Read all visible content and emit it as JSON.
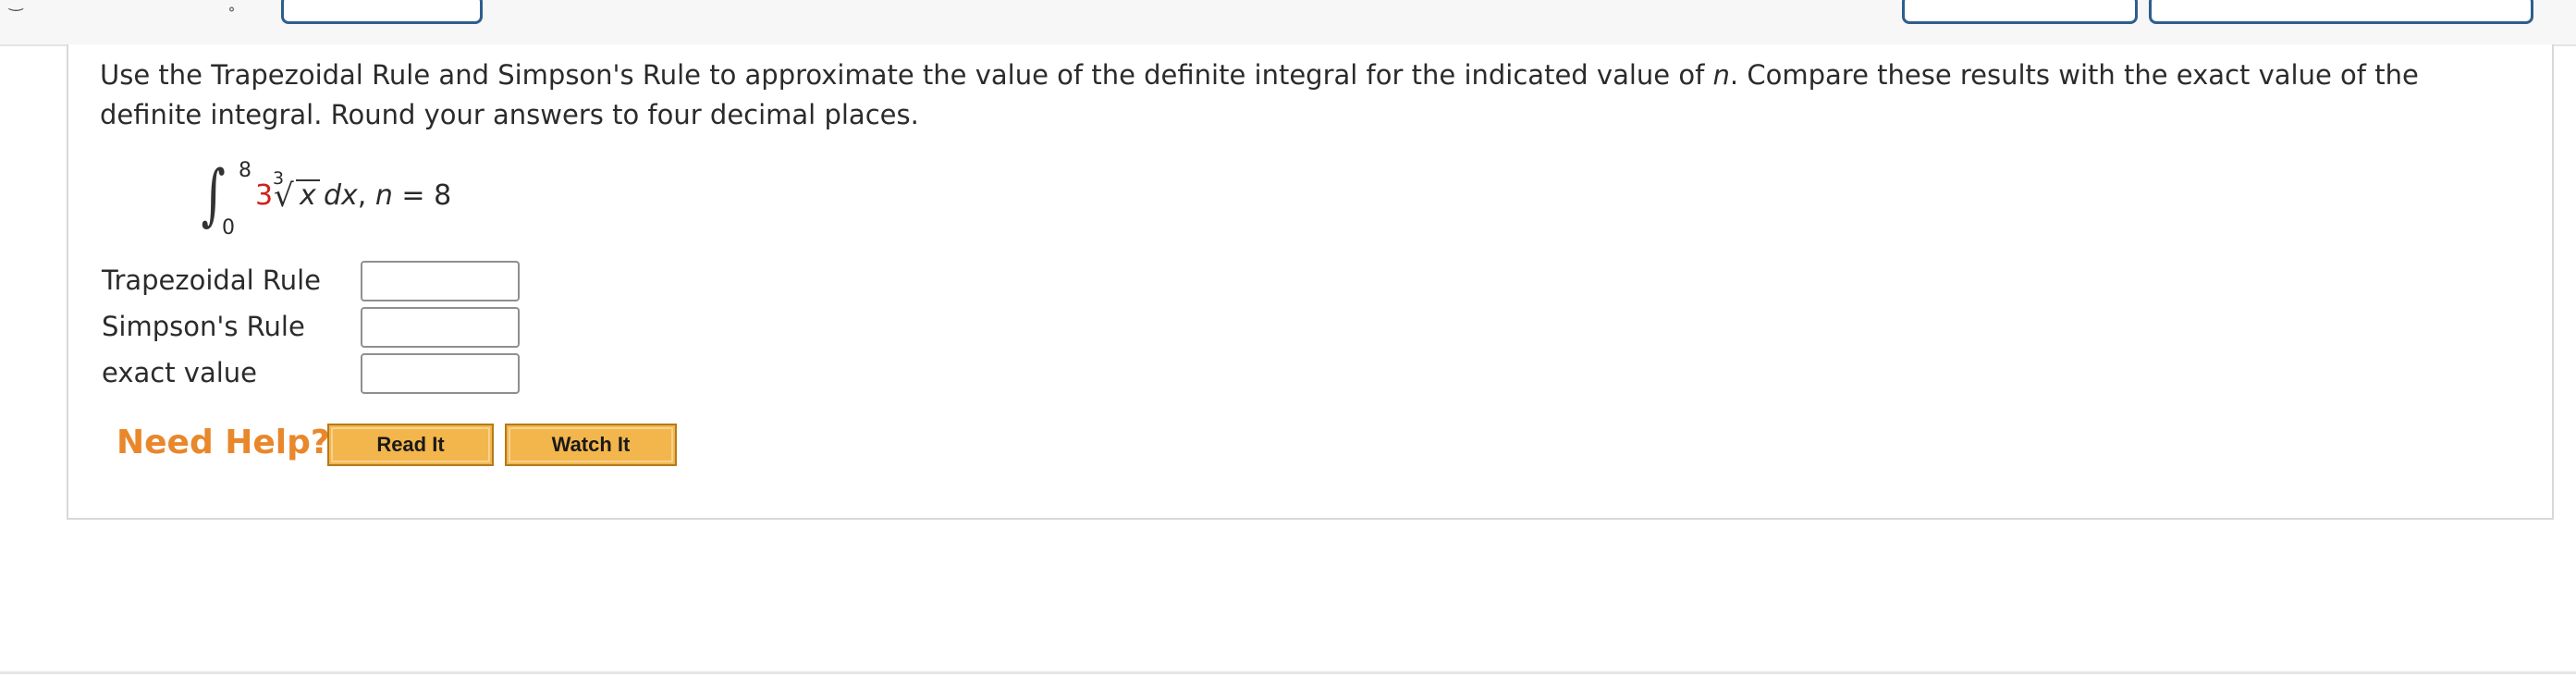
{
  "question": {
    "text_before_n": "Use the Trapezoidal Rule and Simpson's Rule to approximate the value of the definite integral for the indicated value of ",
    "n_symbol": "n",
    "text_after_n": ". Compare these results with the exact value of the definite integral. Round your answers to four decimal places."
  },
  "integral": {
    "lower_limit": "0",
    "upper_limit": "8",
    "coefficient": "3",
    "root_index": "3",
    "radicand": "x",
    "differential": "dx",
    "separator": ", ",
    "n_label": "n",
    "n_equals": " = 8"
  },
  "answers": [
    {
      "label": "Trapezoidal Rule",
      "value": ""
    },
    {
      "label": "Simpson's Rule",
      "value": ""
    },
    {
      "label": "exact value",
      "value": ""
    }
  ],
  "help": {
    "label": "Need Help?",
    "read_it": "Read It",
    "watch_it": "Watch It"
  },
  "colors": {
    "accent_orange": "#e9872b",
    "button_fill": "#f3b64c",
    "coefficient_red": "#d0211c",
    "top_button_border": "#2d5e8e"
  }
}
